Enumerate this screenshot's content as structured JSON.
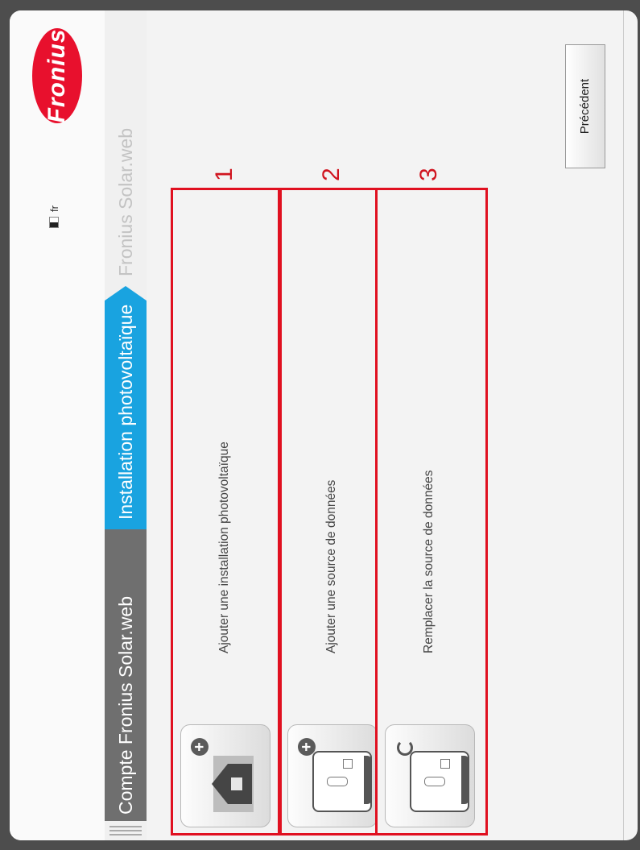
{
  "header": {
    "logo_text": "Fronius",
    "language": "fr"
  },
  "breadcrumb": [
    {
      "label": "Compte Fronius Solar.web"
    },
    {
      "label": "Installation photovoltaïque"
    },
    {
      "label": "Fronius Solar.web"
    }
  ],
  "options": [
    {
      "label": "Ajouter une installation photovoltaïque",
      "number": "1",
      "icon": "house-plus-icon"
    },
    {
      "label": "Ajouter une source de données",
      "number": "2",
      "icon": "datalogger-plus-icon"
    },
    {
      "label": "Remplacer la source de données",
      "number": "3",
      "icon": "datalogger-replace-icon"
    }
  ],
  "footer": {
    "previous_label": "Précédent"
  },
  "colors": {
    "accent": "#19a3e0",
    "brand": "#e8102d",
    "highlight": "#e01020"
  }
}
